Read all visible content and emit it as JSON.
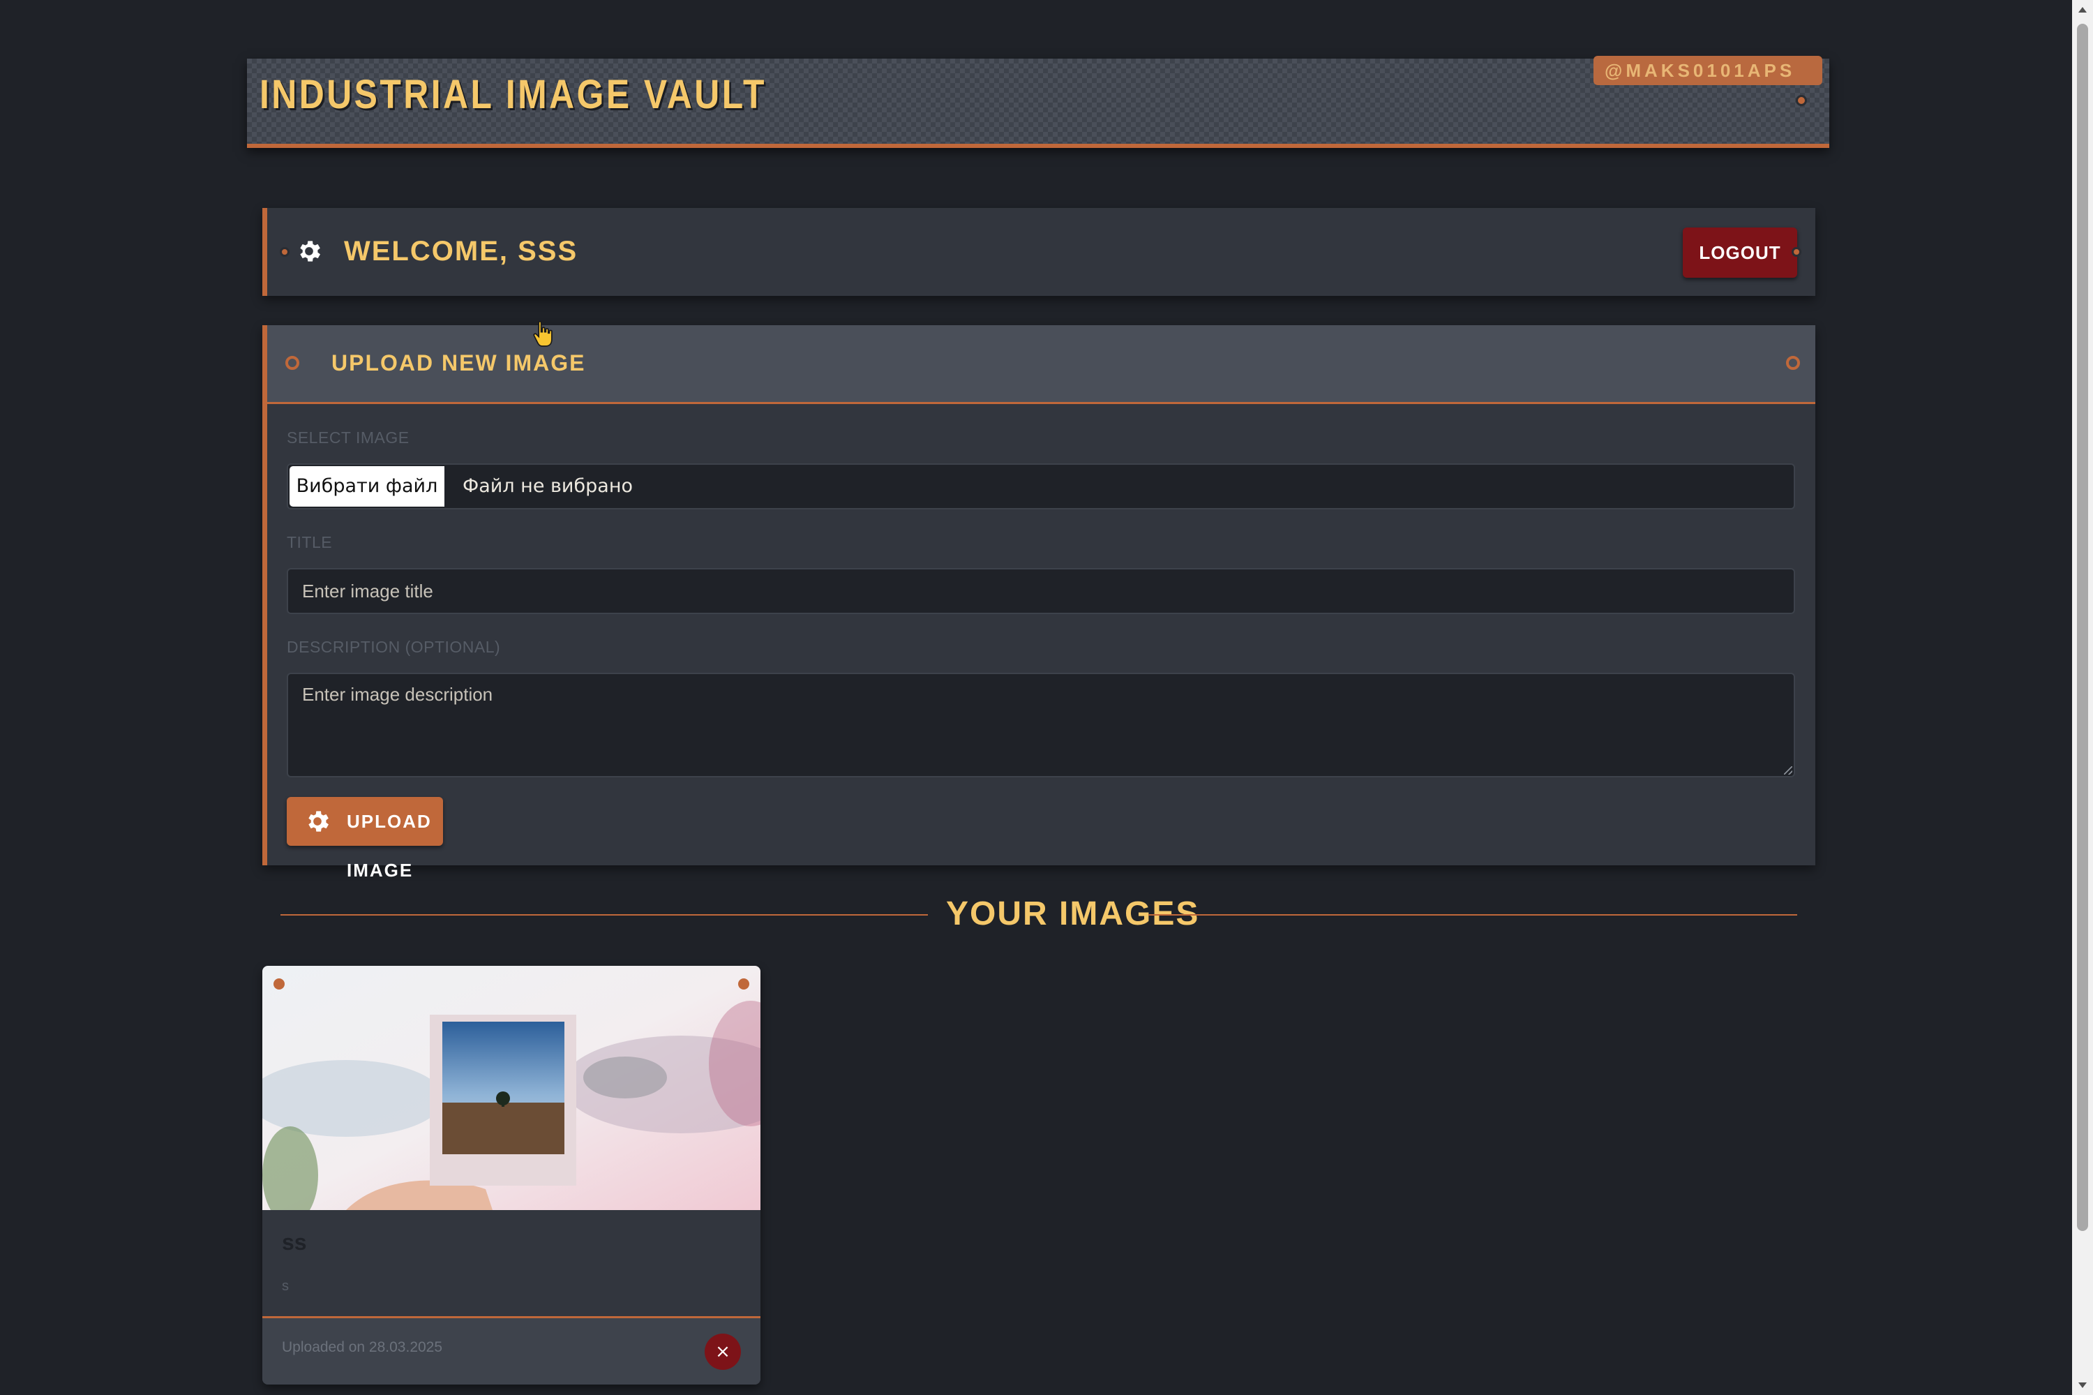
{
  "banner": {
    "title": "INDUSTRIAL IMAGE VAULT",
    "handle": "@MAKS0101APS"
  },
  "welcome": {
    "text": "WELCOME, SSS",
    "logout_label": "LOGOUT",
    "icon": "gear-icon"
  },
  "upload": {
    "heading": "UPLOAD NEW IMAGE",
    "select_label": "SELECT IMAGE",
    "file_button": "Вибрати файл",
    "file_status": "Файл не вибрано",
    "title_label": "TITLE",
    "title_placeholder": "Enter image title",
    "description_label": "DESCRIPTION (OPTIONAL)",
    "description_placeholder": "Enter image description",
    "submit_label": "UPLOAD IMAGE"
  },
  "gallery": {
    "heading": "YOUR IMAGES",
    "cards": [
      {
        "title": "ss",
        "description": "s",
        "uploaded": "Uploaded on 28.03.2025",
        "delete_label": "×"
      }
    ]
  },
  "colors": {
    "accent": "#c0683a",
    "heading": "#f5c86a",
    "danger": "#7d1318",
    "background": "#1f2228",
    "panel": "#32363e"
  }
}
